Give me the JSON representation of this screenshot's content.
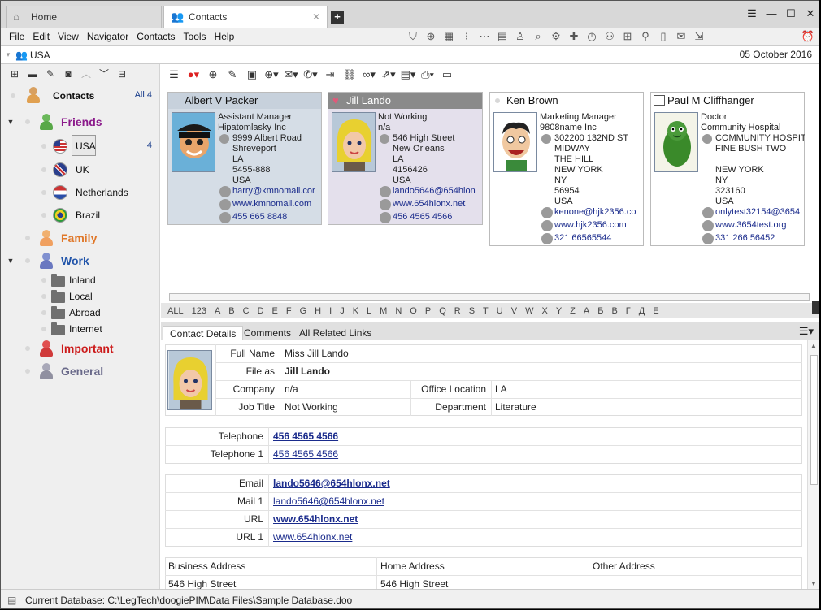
{
  "tabs": [
    {
      "label": "Home",
      "icon": "home-icon"
    },
    {
      "label": "Contacts",
      "icon": "contacts-icon"
    }
  ],
  "menu": [
    "File",
    "Edit",
    "View",
    "Navigator",
    "Contacts",
    "Tools",
    "Help"
  ],
  "address": {
    "path": "USA",
    "date": "05 October 2016"
  },
  "sidebar": {
    "root": {
      "label": "Contacts",
      "count": "All 4"
    },
    "friends": {
      "label": "Friends",
      "color": "#8b1a8b"
    },
    "subgroups": [
      {
        "label": "USA",
        "count": "4"
      },
      {
        "label": "UK"
      },
      {
        "label": "Netherlands"
      },
      {
        "label": "Brazil"
      }
    ],
    "family": {
      "label": "Family",
      "color": "#e0782a"
    },
    "work": {
      "label": "Work",
      "color": "#2255aa"
    },
    "work_folders": [
      "Inland",
      "Local",
      "Abroad",
      "Internet"
    ],
    "important": {
      "label": "Important",
      "color": "#cc1a1a"
    },
    "general": {
      "label": "General",
      "color": "#6a6a8a"
    }
  },
  "cards": [
    {
      "name": "Albert V Packer",
      "title": "Assistant Manager",
      "company": "Hipatomlasky Inc",
      "addr": [
        "9999 Albert Road",
        "Shreveport",
        "LA",
        "5455-888",
        "USA"
      ],
      "email": "harry@kmnomail.cor",
      "web": "www.kmnomail.com",
      "phone": "455 665 8848"
    },
    {
      "name": "Jill Lando",
      "title": "Not Working",
      "company": "n/a",
      "addr": [
        "546 High Street",
        "New Orleans",
        "LA",
        "4156426",
        "USA"
      ],
      "email": "lando5646@654hlon",
      "web": "www.654hlonx.net",
      "phone": "456 4565 4566"
    },
    {
      "name": "Ken Brown",
      "title": "Marketing Manager",
      "company": "9808name Inc",
      "addr": [
        "302200 132ND ST",
        "MIDWAY",
        "THE HILL",
        "NEW YORK",
        "NY",
        "56954",
        "USA"
      ],
      "email": "kenone@hjk2356.co",
      "web": "www.hjk2356.com",
      "phone": "321 66565544"
    },
    {
      "name": "Paul M Cliffhanger",
      "title": "Doctor",
      "company": "Community Hospital",
      "addr": [
        "COMMUNITY HOSPIT.",
        "FINE BUSH TWO",
        "",
        "NEW YORK",
        "NY",
        "323160",
        "USA"
      ],
      "email": "onlytest32154@3654",
      "web": "www.3654test.org",
      "phone": "331 266 56452"
    }
  ],
  "alphabet": [
    "ALL",
    "123",
    "A",
    "B",
    "C",
    "D",
    "E",
    "F",
    "G",
    "H",
    "I",
    "J",
    "K",
    "L",
    "M",
    "N",
    "O",
    "P",
    "Q",
    "R",
    "S",
    "T",
    "U",
    "V",
    "W",
    "X",
    "Y",
    "Z",
    "А",
    "Б",
    "В",
    "Г",
    "Д",
    "Е"
  ],
  "detail_tabs": [
    "Contact Details",
    "Comments",
    "All Related Links"
  ],
  "detail": {
    "full_name_label": "Full Name",
    "full_name": "Miss Jill Lando",
    "file_as_label": "File as",
    "file_as": "Jill Lando",
    "company_label": "Company",
    "company": "n/a",
    "office_label": "Office Location",
    "office": "LA",
    "job_label": "Job Title",
    "job": "Not Working",
    "dept_label": "Department",
    "dept": "Literature",
    "tel_label": "Telephone",
    "tel": "456 4565 4566",
    "tel1_label": "Telephone 1",
    "tel1": "456 4565 4566",
    "email_label": "Email",
    "email": "lando5646@654hlonx.net",
    "mail1_label": "Mail 1",
    "mail1": "lando5646@654hlonx.net",
    "url_label": "URL",
    "url": "www.654hlonx.net",
    "url1_label": "URL 1",
    "url1": "www.654hlonx.net",
    "biz_addr_label": "Business Address",
    "home_addr_label": "Home Address",
    "other_addr_label": "Other Address",
    "biz_addr": "546 High Street",
    "home_addr": "546 High Street"
  },
  "status": "Current Database: C:\\LegTech\\doogiePIM\\Data Files\\Sample Database.doo"
}
